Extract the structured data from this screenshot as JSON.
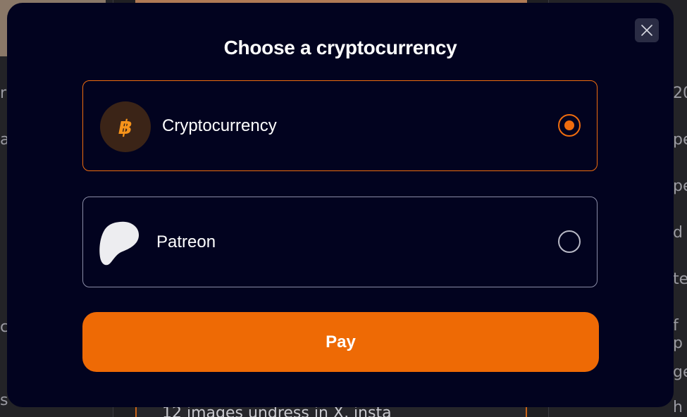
{
  "modal": {
    "title": "Choose a cryptocurrency",
    "close_icon": "close-icon",
    "options": [
      {
        "label": "Cryptocurrency",
        "icon": "bitcoin-icon",
        "selected": true
      },
      {
        "label": "Patreon",
        "icon": "patreon-icon",
        "selected": false
      }
    ],
    "pay_label": "Pay"
  },
  "background": {
    "right_letters": [
      "20",
      "pe",
      "pe",
      "d",
      "te",
      "f p",
      "ge",
      "h"
    ],
    "left_letters": [
      "r",
      "a",
      "c",
      "s"
    ],
    "bottom_text": "12 images undress in X, insta"
  },
  "colors": {
    "modal_bg": "#02031f",
    "accent": "#ef6c0e",
    "text": "#ffffff",
    "unselected_border": "#8a8ca6"
  }
}
